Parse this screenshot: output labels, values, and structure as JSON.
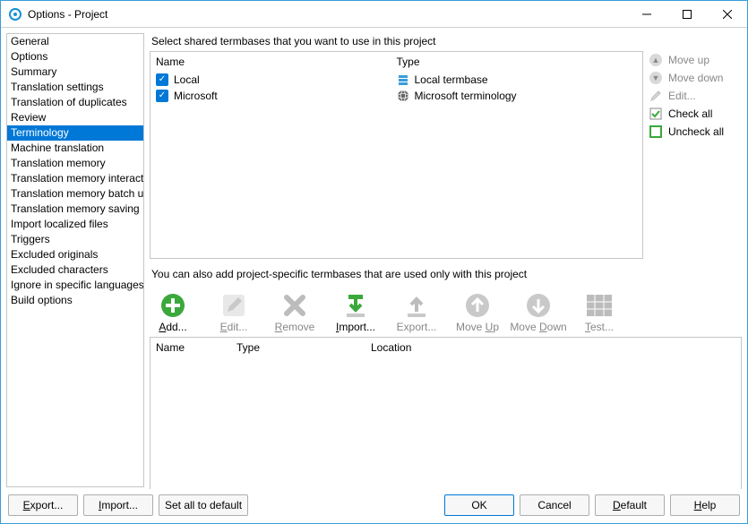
{
  "window": {
    "title": "Options - Project"
  },
  "sidebar": {
    "items": [
      {
        "label": "General"
      },
      {
        "label": "Options"
      },
      {
        "label": "Summary"
      },
      {
        "label": "Translation settings"
      },
      {
        "label": "Translation of duplicates"
      },
      {
        "label": "Review"
      },
      {
        "label": "Terminology",
        "selected": true
      },
      {
        "label": "Machine translation"
      },
      {
        "label": "Translation memory"
      },
      {
        "label": "Translation memory interactive"
      },
      {
        "label": "Translation memory batch usage"
      },
      {
        "label": "Translation memory saving"
      },
      {
        "label": "Import localized files"
      },
      {
        "label": "Triggers"
      },
      {
        "label": "Excluded originals"
      },
      {
        "label": "Excluded characters"
      },
      {
        "label": "Ignore in specific languages"
      },
      {
        "label": "Build options"
      }
    ]
  },
  "shared": {
    "heading": "Select shared termbases that you want to use in this project",
    "columns": {
      "name": "Name",
      "type": "Type"
    },
    "rows": [
      {
        "checked": true,
        "name": "Local",
        "type": "Local termbase",
        "icon": "db"
      },
      {
        "checked": true,
        "name": "Microsoft",
        "type": "Microsoft terminology",
        "icon": "globe"
      }
    ]
  },
  "sideactions": {
    "moveup": "Move up",
    "movedown": "Move down",
    "edit": "Edit...",
    "checkall": "Check all",
    "uncheckall": "Uncheck all"
  },
  "project": {
    "heading": "You can also add project-specific termbases that are used only with this project",
    "toolbar": {
      "add": "Add...",
      "edit": "Edit...",
      "remove": "Remove",
      "import": "Import...",
      "export": "Export...",
      "moveup": "Move Up",
      "movedown": "Move Down",
      "test": "Test..."
    },
    "columns": {
      "name": "Name",
      "type": "Type",
      "location": "Location"
    }
  },
  "bottom": {
    "export": "Export...",
    "import": "Import...",
    "setall": "Set all to default",
    "ok": "OK",
    "cancel": "Cancel",
    "default": "Default",
    "help": "Help"
  }
}
